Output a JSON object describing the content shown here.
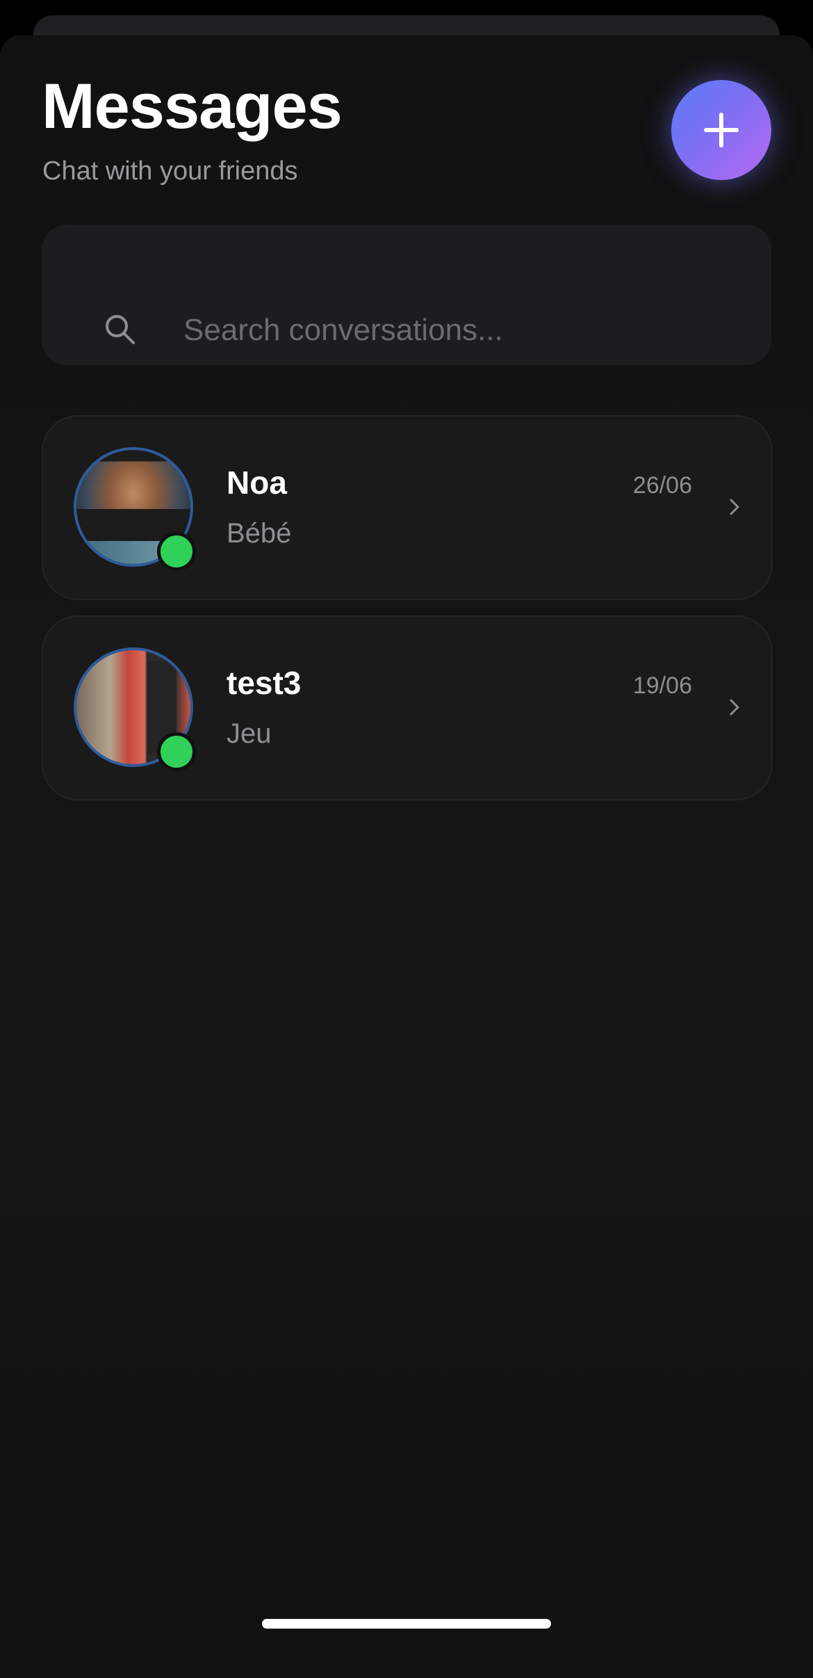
{
  "header": {
    "title": "Messages",
    "subtitle": "Chat with your friends"
  },
  "new_chat_button": {
    "icon": "plus-icon",
    "accent_gradient": [
      "#5b7cf6",
      "#b56af0"
    ]
  },
  "search": {
    "placeholder": "Search conversations...",
    "value": "",
    "icon": "search-icon"
  },
  "conversations": [
    {
      "name": "Noa",
      "last_message": "Bébé",
      "date": "26/06",
      "online": true
    },
    {
      "name": "test3",
      "last_message": "Jeu",
      "date": "19/06",
      "online": true
    }
  ],
  "colors": {
    "background": "#111111",
    "card": "#1a1a1a",
    "online": "#30d158",
    "avatar_ring": "#2f5b9c"
  }
}
